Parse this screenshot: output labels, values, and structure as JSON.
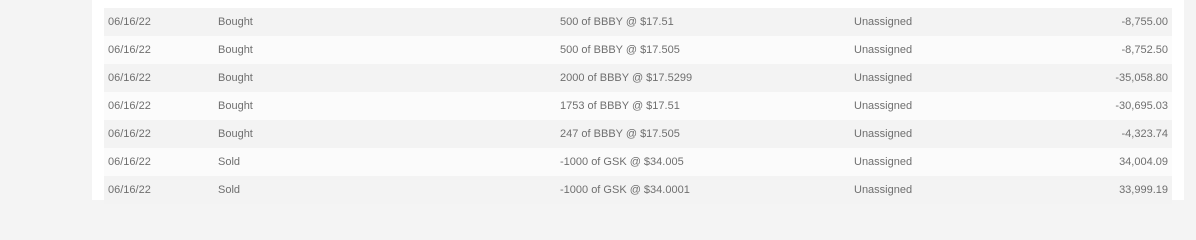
{
  "transactions": [
    {
      "date": "06/16/22",
      "action": "Bought",
      "description": "500 of BBBY @ $17.51",
      "account": "Unassigned",
      "amount": "-8,755.00"
    },
    {
      "date": "06/16/22",
      "action": "Bought",
      "description": "500 of BBBY @ $17.505",
      "account": "Unassigned",
      "amount": "-8,752.50"
    },
    {
      "date": "06/16/22",
      "action": "Bought",
      "description": "2000 of BBBY @ $17.5299",
      "account": "Unassigned",
      "amount": "-35,058.80"
    },
    {
      "date": "06/16/22",
      "action": "Bought",
      "description": "1753 of BBBY @ $17.51",
      "account": "Unassigned",
      "amount": "-30,695.03"
    },
    {
      "date": "06/16/22",
      "action": "Bought",
      "description": "247 of BBBY @ $17.505",
      "account": "Unassigned",
      "amount": "-4,323.74"
    },
    {
      "date": "06/16/22",
      "action": "Sold",
      "description": "-1000 of GSK @ $34.005",
      "account": "Unassigned",
      "amount": "34,004.09"
    },
    {
      "date": "06/16/22",
      "action": "Sold",
      "description": "-1000 of GSK @ $34.0001",
      "account": "Unassigned",
      "amount": "33,999.19"
    }
  ]
}
